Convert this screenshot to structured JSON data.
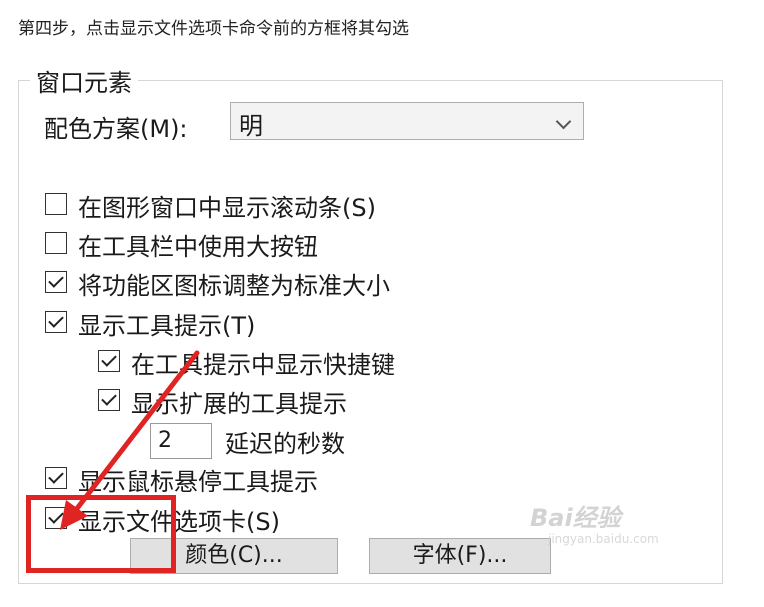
{
  "instruction": "第四步，点击显示文件选项卡命令前的方框将其勾选",
  "group": {
    "title": "窗口元素",
    "color_scheme_label": "配色方案(M):",
    "color_scheme_value": "明"
  },
  "checkboxes": [
    {
      "label": "在图形窗口中显示滚动条(S)",
      "checked": false
    },
    {
      "label": "在工具栏中使用大按钮",
      "checked": false
    },
    {
      "label": "将功能区图标调整为标准大小",
      "checked": true
    },
    {
      "label": "显示工具提示(T)",
      "checked": true
    },
    {
      "label": "在工具提示中显示快捷键",
      "checked": true
    },
    {
      "label": "显示扩展的工具提示",
      "checked": true
    },
    {
      "label": "显示鼠标悬停工具提示",
      "checked": true
    },
    {
      "label": "显示文件选项卡(S)",
      "checked": true
    }
  ],
  "delay": {
    "value": "2",
    "label": "延迟的秒数"
  },
  "buttons": {
    "colors": "颜色(C)...",
    "fonts": "字体(F)..."
  },
  "watermark": {
    "text": "Bai经验",
    "sub": "jingyan.baidu.com"
  },
  "colors": {
    "highlight": "#e02323"
  }
}
